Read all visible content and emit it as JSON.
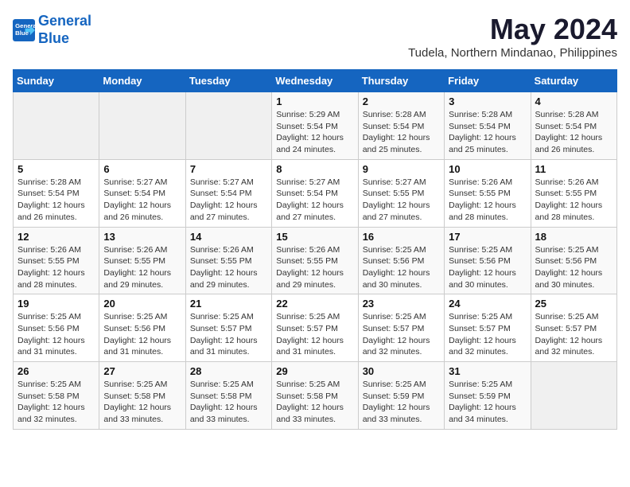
{
  "logo": {
    "line1": "General",
    "line2": "Blue"
  },
  "title": "May 2024",
  "subtitle": "Tudela, Northern Mindanao, Philippines",
  "days_of_week": [
    "Sunday",
    "Monday",
    "Tuesday",
    "Wednesday",
    "Thursday",
    "Friday",
    "Saturday"
  ],
  "weeks": [
    [
      {
        "day": "",
        "info": ""
      },
      {
        "day": "",
        "info": ""
      },
      {
        "day": "",
        "info": ""
      },
      {
        "day": "1",
        "info": "Sunrise: 5:29 AM\nSunset: 5:54 PM\nDaylight: 12 hours\nand 24 minutes."
      },
      {
        "day": "2",
        "info": "Sunrise: 5:28 AM\nSunset: 5:54 PM\nDaylight: 12 hours\nand 25 minutes."
      },
      {
        "day": "3",
        "info": "Sunrise: 5:28 AM\nSunset: 5:54 PM\nDaylight: 12 hours\nand 25 minutes."
      },
      {
        "day": "4",
        "info": "Sunrise: 5:28 AM\nSunset: 5:54 PM\nDaylight: 12 hours\nand 26 minutes."
      }
    ],
    [
      {
        "day": "5",
        "info": "Sunrise: 5:28 AM\nSunset: 5:54 PM\nDaylight: 12 hours\nand 26 minutes."
      },
      {
        "day": "6",
        "info": "Sunrise: 5:27 AM\nSunset: 5:54 PM\nDaylight: 12 hours\nand 26 minutes."
      },
      {
        "day": "7",
        "info": "Sunrise: 5:27 AM\nSunset: 5:54 PM\nDaylight: 12 hours\nand 27 minutes."
      },
      {
        "day": "8",
        "info": "Sunrise: 5:27 AM\nSunset: 5:54 PM\nDaylight: 12 hours\nand 27 minutes."
      },
      {
        "day": "9",
        "info": "Sunrise: 5:27 AM\nSunset: 5:55 PM\nDaylight: 12 hours\nand 27 minutes."
      },
      {
        "day": "10",
        "info": "Sunrise: 5:26 AM\nSunset: 5:55 PM\nDaylight: 12 hours\nand 28 minutes."
      },
      {
        "day": "11",
        "info": "Sunrise: 5:26 AM\nSunset: 5:55 PM\nDaylight: 12 hours\nand 28 minutes."
      }
    ],
    [
      {
        "day": "12",
        "info": "Sunrise: 5:26 AM\nSunset: 5:55 PM\nDaylight: 12 hours\nand 28 minutes."
      },
      {
        "day": "13",
        "info": "Sunrise: 5:26 AM\nSunset: 5:55 PM\nDaylight: 12 hours\nand 29 minutes."
      },
      {
        "day": "14",
        "info": "Sunrise: 5:26 AM\nSunset: 5:55 PM\nDaylight: 12 hours\nand 29 minutes."
      },
      {
        "day": "15",
        "info": "Sunrise: 5:26 AM\nSunset: 5:55 PM\nDaylight: 12 hours\nand 29 minutes."
      },
      {
        "day": "16",
        "info": "Sunrise: 5:25 AM\nSunset: 5:56 PM\nDaylight: 12 hours\nand 30 minutes."
      },
      {
        "day": "17",
        "info": "Sunrise: 5:25 AM\nSunset: 5:56 PM\nDaylight: 12 hours\nand 30 minutes."
      },
      {
        "day": "18",
        "info": "Sunrise: 5:25 AM\nSunset: 5:56 PM\nDaylight: 12 hours\nand 30 minutes."
      }
    ],
    [
      {
        "day": "19",
        "info": "Sunrise: 5:25 AM\nSunset: 5:56 PM\nDaylight: 12 hours\nand 31 minutes."
      },
      {
        "day": "20",
        "info": "Sunrise: 5:25 AM\nSunset: 5:56 PM\nDaylight: 12 hours\nand 31 minutes."
      },
      {
        "day": "21",
        "info": "Sunrise: 5:25 AM\nSunset: 5:57 PM\nDaylight: 12 hours\nand 31 minutes."
      },
      {
        "day": "22",
        "info": "Sunrise: 5:25 AM\nSunset: 5:57 PM\nDaylight: 12 hours\nand 31 minutes."
      },
      {
        "day": "23",
        "info": "Sunrise: 5:25 AM\nSunset: 5:57 PM\nDaylight: 12 hours\nand 32 minutes."
      },
      {
        "day": "24",
        "info": "Sunrise: 5:25 AM\nSunset: 5:57 PM\nDaylight: 12 hours\nand 32 minutes."
      },
      {
        "day": "25",
        "info": "Sunrise: 5:25 AM\nSunset: 5:57 PM\nDaylight: 12 hours\nand 32 minutes."
      }
    ],
    [
      {
        "day": "26",
        "info": "Sunrise: 5:25 AM\nSunset: 5:58 PM\nDaylight: 12 hours\nand 32 minutes."
      },
      {
        "day": "27",
        "info": "Sunrise: 5:25 AM\nSunset: 5:58 PM\nDaylight: 12 hours\nand 33 minutes."
      },
      {
        "day": "28",
        "info": "Sunrise: 5:25 AM\nSunset: 5:58 PM\nDaylight: 12 hours\nand 33 minutes."
      },
      {
        "day": "29",
        "info": "Sunrise: 5:25 AM\nSunset: 5:58 PM\nDaylight: 12 hours\nand 33 minutes."
      },
      {
        "day": "30",
        "info": "Sunrise: 5:25 AM\nSunset: 5:59 PM\nDaylight: 12 hours\nand 33 minutes."
      },
      {
        "day": "31",
        "info": "Sunrise: 5:25 AM\nSunset: 5:59 PM\nDaylight: 12 hours\nand 34 minutes."
      },
      {
        "day": "",
        "info": ""
      }
    ]
  ]
}
